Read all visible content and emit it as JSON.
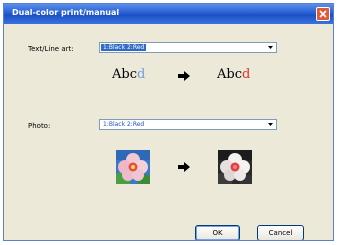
{
  "window": {
    "title": "Dual-color print/manual"
  },
  "textline": {
    "label": "Text/Line art:",
    "value": "1:Black 2:Red",
    "before": {
      "a": "Abc",
      "b": "d"
    },
    "after": {
      "a": "Abc",
      "b": "d"
    }
  },
  "photo": {
    "label": "Photo:",
    "value": "1:Black 2:Red"
  },
  "buttons": {
    "ok": "OK",
    "cancel": "Cancel"
  },
  "icons": {
    "close": "close-icon",
    "dropdown": "chevron-down-icon",
    "arrow": "arrow-right-icon"
  }
}
